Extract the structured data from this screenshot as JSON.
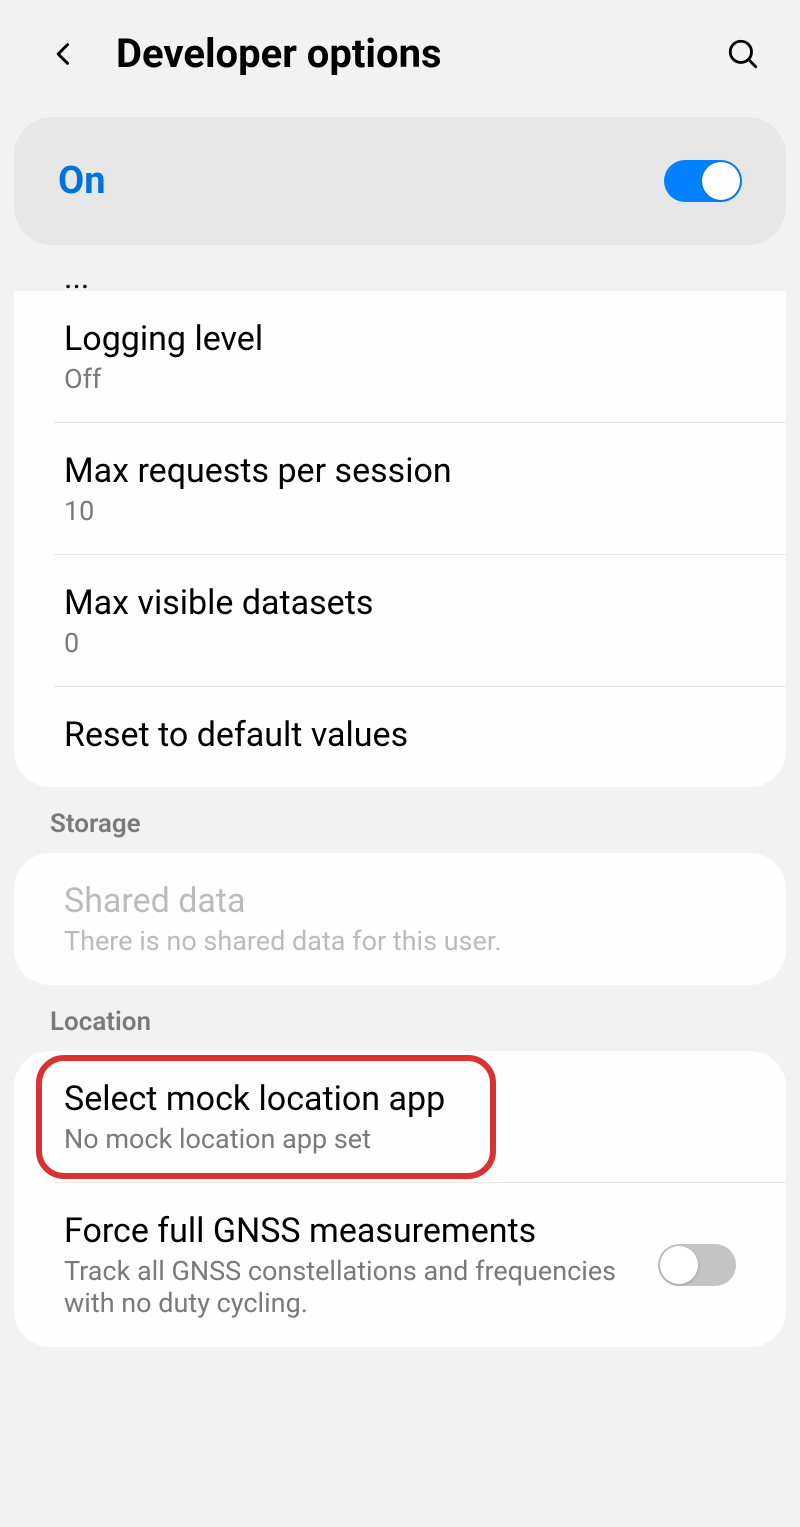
{
  "header": {
    "title": "Developer options"
  },
  "masterToggle": {
    "label": "On",
    "state": "on"
  },
  "sections": {
    "first": {
      "items": [
        {
          "title": "Logging level",
          "subtitle": "Off"
        },
        {
          "title": "Max requests per session",
          "subtitle": "10"
        },
        {
          "title": "Max visible datasets",
          "subtitle": "0"
        },
        {
          "title": "Reset to default values"
        }
      ]
    },
    "storage": {
      "label": "Storage",
      "items": [
        {
          "title": "Shared data",
          "subtitle": "There is no shared data for this user.",
          "disabled": true
        }
      ]
    },
    "location": {
      "label": "Location",
      "items": [
        {
          "title": "Select mock location app",
          "subtitle": "No mock location app set",
          "highlighted": true
        },
        {
          "title": "Force full GNSS measurements",
          "subtitle": "Track all GNSS constellations and frequencies with no duty cycling.",
          "toggle": "off"
        }
      ]
    }
  }
}
